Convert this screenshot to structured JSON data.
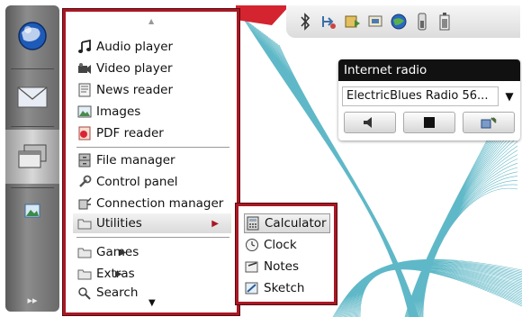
{
  "menu": {
    "scroll_up": "▲",
    "scroll_down": "▼",
    "items": [
      {
        "label": "Audio player",
        "icon": "music-note-icon"
      },
      {
        "label": "Video player",
        "icon": "video-camera-icon"
      },
      {
        "label": "News reader",
        "icon": "newspaper-icon"
      },
      {
        "label": "Images",
        "icon": "image-icon"
      },
      {
        "label": "PDF reader",
        "icon": "pdf-icon"
      },
      {
        "label": "File manager",
        "icon": "file-cabinet-icon"
      },
      {
        "label": "Control panel",
        "icon": "wrench-icon"
      },
      {
        "label": "Connection manager",
        "icon": "connection-icon"
      },
      {
        "label": "Utilities",
        "icon": "folder-icon",
        "has_submenu": true,
        "selected": true
      },
      {
        "label": "Games",
        "icon": "folder-icon",
        "has_submenu": true
      },
      {
        "label": "Extras",
        "icon": "folder-icon",
        "has_submenu": true
      },
      {
        "label": "Search",
        "icon": "search-icon"
      }
    ]
  },
  "submenu": {
    "items": [
      {
        "label": "Calculator",
        "icon": "calculator-icon",
        "selected": true
      },
      {
        "label": "Clock",
        "icon": "clock-icon"
      },
      {
        "label": "Notes",
        "icon": "notes-icon"
      },
      {
        "label": "Sketch",
        "icon": "sketch-icon"
      }
    ]
  },
  "radio": {
    "title": "Internet radio",
    "station": "ElectricBlues Radio 56...",
    "dropdown": "▼"
  },
  "taskbar": {
    "expand": "▸▸"
  },
  "colors": {
    "accent_red": "#a81824",
    "taskbar": "#6a6a6a"
  }
}
